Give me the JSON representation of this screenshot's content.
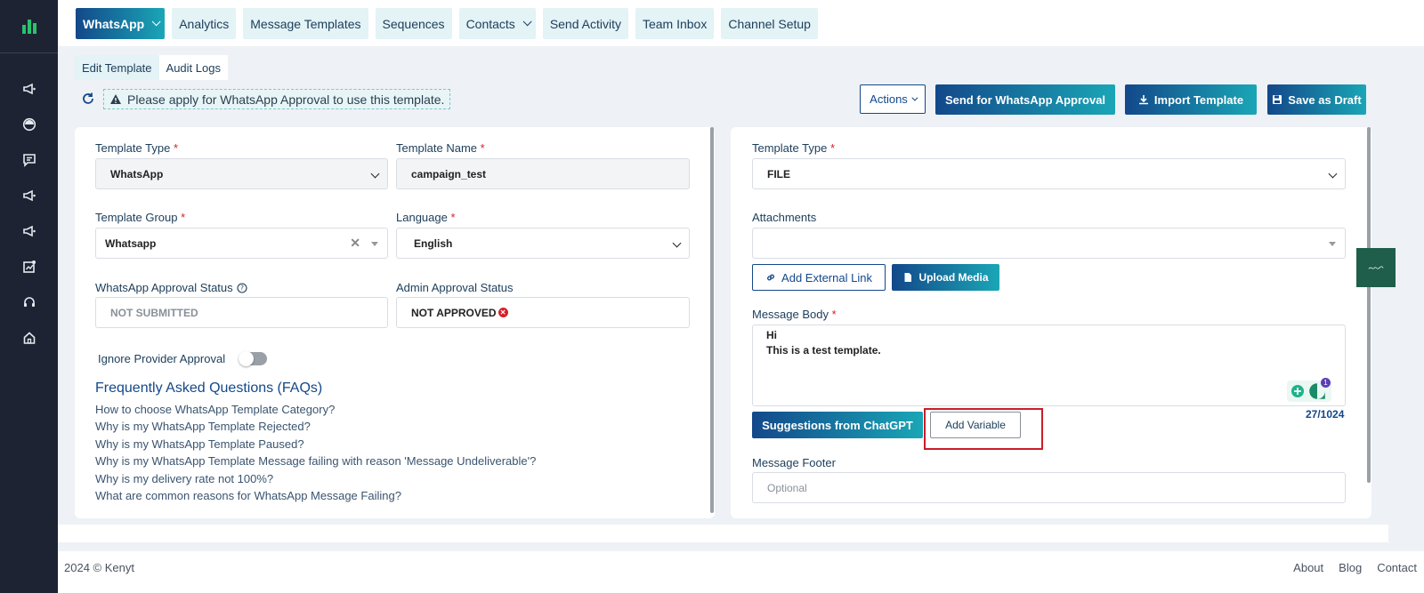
{
  "app": {
    "brand_color": "#13488a",
    "accent_color": "#1aa6b6",
    "sidebar_color": "#1d2333"
  },
  "sidebar": {
    "items": [
      "megaphone-icon",
      "dashboard-icon",
      "chat-icon",
      "megaphone-icon",
      "megaphone-icon",
      "report-icon",
      "headset-icon",
      "home-icon"
    ]
  },
  "topnav": {
    "tabs": [
      {
        "label": "WhatsApp",
        "active": true,
        "dropdown": true
      },
      {
        "label": "Analytics"
      },
      {
        "label": "Message Templates"
      },
      {
        "label": "Sequences"
      },
      {
        "label": "Contacts",
        "dropdown": true
      },
      {
        "label": "Send Activity"
      },
      {
        "label": "Team Inbox"
      },
      {
        "label": "Channel Setup"
      }
    ]
  },
  "subtabs": {
    "edit": "Edit Template",
    "audit": "Audit Logs"
  },
  "alert": {
    "text": "Please apply for WhatsApp Approval to use this template."
  },
  "actions": {
    "actions": "Actions",
    "send": "Send for WhatsApp Approval",
    "import": "Import Template",
    "save": "Save as Draft"
  },
  "left": {
    "template_type": {
      "label": "Template Type",
      "value": "WhatsApp"
    },
    "template_name": {
      "label": "Template Name",
      "value": "campaign_test"
    },
    "template_group": {
      "label": "Template Group",
      "value": "Whatsapp"
    },
    "language": {
      "label": "Language",
      "value": "English"
    },
    "wa_status": {
      "label": "WhatsApp Approval Status",
      "value": "NOT SUBMITTED"
    },
    "admin_status": {
      "label": "Admin Approval Status",
      "value": "NOT APPROVED"
    },
    "ignore_label": "Ignore Provider Approval",
    "ignore_on": false,
    "faq_title": "Frequently Asked Questions (FAQs)",
    "faqs": [
      "How to choose WhatsApp Template Category?",
      "Why is my WhatsApp Template Rejected?",
      "Why is my WhatsApp Template Paused?",
      "Why is my WhatsApp Template Message failing with reason 'Message Undeliverable'?",
      "Why is my delivery rate not 100%?",
      "What are common reasons for WhatsApp Message Failing?"
    ]
  },
  "right": {
    "template_type": {
      "label": "Template Type",
      "value": "FILE"
    },
    "attachments": {
      "label": "Attachments",
      "value": ""
    },
    "add_link": "Add External Link",
    "upload": "Upload Media",
    "body": {
      "label": "Message Body",
      "line1": "Hi",
      "line2": "This is a test template."
    },
    "grammar_badge": "1",
    "counter": "27/1024",
    "suggest": "Suggestions from ChatGPT",
    "add_variable": "Add Variable",
    "footer": {
      "label": "Message Footer",
      "placeholder": "Optional"
    }
  },
  "footer": {
    "copy": "2024 © Kenyt",
    "links": [
      "About",
      "Blog",
      "Contact"
    ]
  }
}
